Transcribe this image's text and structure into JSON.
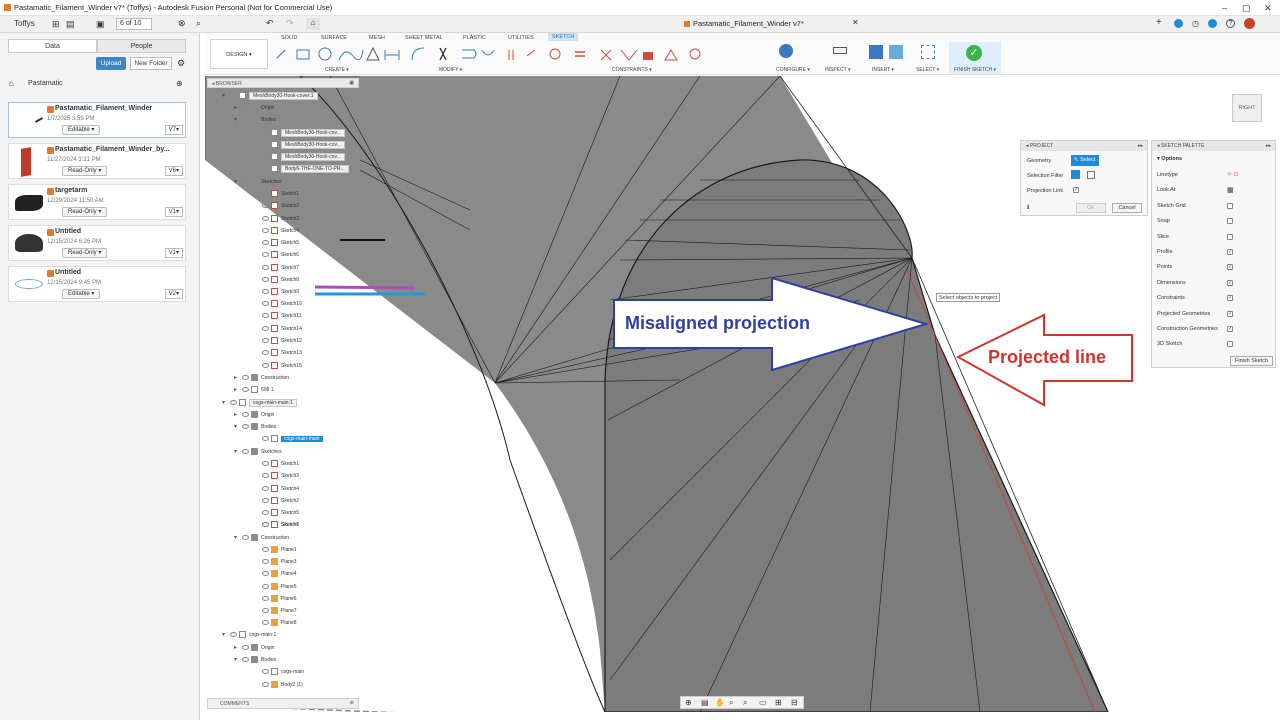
{
  "window": {
    "title": "Pastamatic_Filament_Winder v7* (Toffys) - Autodesk Fusion Personal (Not for Commercial Use)",
    "doc_tab": "Pastamatic_Filament_Winder v7*"
  },
  "quick_access": {
    "user": "Toffys",
    "pager": "6 of 10"
  },
  "data_panel": {
    "tabs": [
      "Data",
      "People"
    ],
    "upload": "Upload",
    "new_folder": "New Folder",
    "breadcrumb": "Pastamatic",
    "files": [
      {
        "name": "Pastamatic_Filament_Winder",
        "date": "1/7/2025 3:59 PM",
        "mode": "Editable",
        "ver": "V7"
      },
      {
        "name": "Pastamatic_Filament_Winder_by...",
        "date": "11/27/2024 3:31 PM",
        "mode": "Read-Only",
        "ver": "V6"
      },
      {
        "name": "targetarm",
        "date": "12/29/2024 11:50 AM",
        "mode": "Read-Only",
        "ver": "V1"
      },
      {
        "name": "Untitled",
        "date": "12/15/2024 6:26 PM",
        "mode": "Read-Only",
        "ver": "V1"
      },
      {
        "name": "Untitled",
        "date": "12/15/2024 9:45 PM",
        "mode": "Editable",
        "ver": "V2"
      }
    ]
  },
  "toolbar": {
    "design": "DESIGN",
    "tabs": [
      "SOLID",
      "SURFACE",
      "MESH",
      "SHEET METAL",
      "PLASTIC",
      "UTILITIES",
      "SKETCH"
    ],
    "groups": [
      "CREATE",
      "MODIFY",
      "CONSTRAINTS",
      "CONFIGURE",
      "INSPECT",
      "INSERT",
      "SELECT",
      "FINISH SKETCH"
    ]
  },
  "browser": {
    "title": "BROWSER",
    "comments": "COMMENTS",
    "items": [
      "MeshBody30-Hook-cover:1",
      "Origin",
      "Bodies",
      "MeshBody30-Hook-cov...",
      "MeshBody30-Hook-cov...",
      "MeshBody30-Hook-cov...",
      "Body6-THE-ONE-TO-PR...",
      "Sketches",
      "Sketch1",
      "Sketch2",
      "Sketch3",
      "Sketch4",
      "Sketch5",
      "Sketch6",
      "Sketch7",
      "Sketch8",
      "Sketch9",
      "Sketch10",
      "Sketch11",
      "Sketch14",
      "Sketch12",
      "Sketch13",
      "Sketch15",
      "Construction",
      "608:1",
      "cogs-main-main:1",
      "Origin",
      "Bodies",
      "cogs-main-main",
      "Sketches",
      "Sketch1",
      "Sketch3",
      "Sketch4",
      "Sketch2",
      "Sketch5",
      "Sketch6",
      "Sketch7",
      "Construction",
      "Plane1",
      "Plane3",
      "Plane4",
      "Plane5",
      "Plane6",
      "Plane7",
      "Plane8",
      "cogs-main:1",
      "Origin",
      "Bodies",
      "cogs-main",
      "Body2 (1)"
    ]
  },
  "project_panel": {
    "title": "PROJECT",
    "geometry": "Geometry",
    "select": "Select",
    "selection_filter": "Selection Filter",
    "projection_link": "Projection Link",
    "ok": "OK",
    "cancel": "Cancel"
  },
  "palette": {
    "title": "SKETCH PALETTE",
    "options": "Options",
    "rows": [
      "Linetype",
      "Look At",
      "Sketch Grid",
      "Snap",
      "Slice",
      "Profile",
      "Points",
      "Dimensions",
      "Constraints",
      "Projected Geometries",
      "Construction Geometries",
      "3D Sketch"
    ],
    "checked": [
      false,
      false,
      false,
      false,
      false,
      true,
      true,
      true,
      true,
      true,
      true,
      false
    ],
    "finish": "Finish Sketch"
  },
  "viewport": {
    "tooltip": "Select objects to project",
    "view_cube": "RIGHT",
    "callout_left": "Misaligned projection",
    "callout_right": "Projected line"
  },
  "colors": {
    "accent": "#1e8bd6",
    "finish_green": "#3bb54a",
    "callout_blue": "#2f3f9f",
    "callout_red": "#d0342c"
  }
}
